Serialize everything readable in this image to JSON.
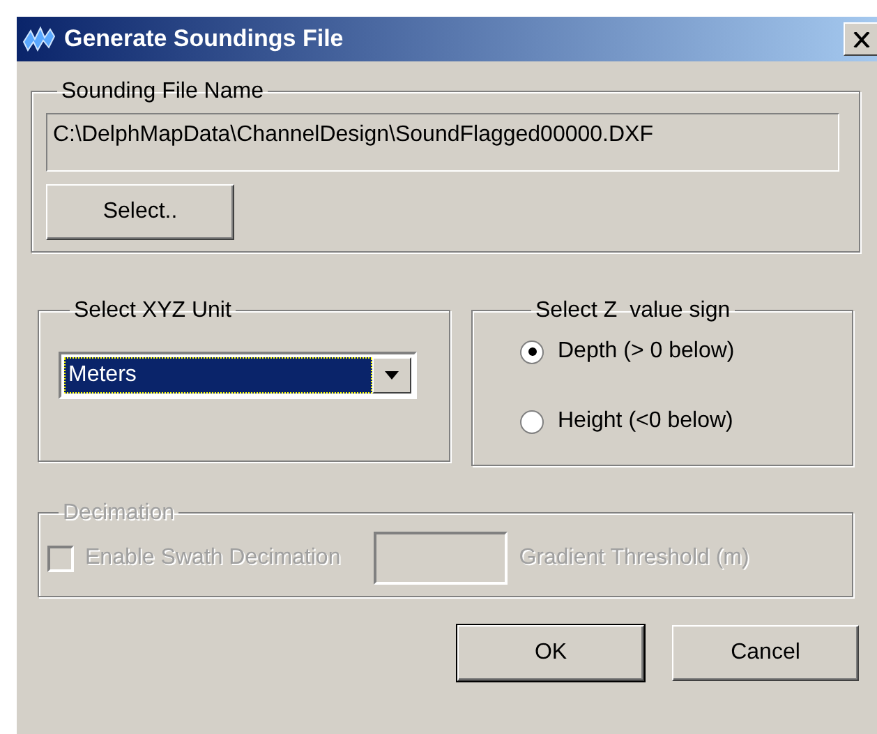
{
  "window": {
    "title": "Generate Soundings File"
  },
  "file_group": {
    "title": "Sounding File Name",
    "path": "C:\\DelphMapData\\ChannelDesign\\SoundFlagged00000.DXF",
    "button": "Select.."
  },
  "unit_group": {
    "title": "Select XYZ Unit",
    "value": "Meters"
  },
  "sign_group": {
    "title": "Select Z  value sign",
    "options": [
      {
        "label": "Depth (> 0 below)",
        "selected": true
      },
      {
        "label": "Height (<0 below)",
        "selected": false
      }
    ]
  },
  "decimation": {
    "title": "Decimation",
    "disabled": true,
    "checkbox": {
      "label": "Enable Swath Decimation",
      "checked": false
    },
    "threshold_label": "Gradient Threshold (m)"
  },
  "buttons": [
    {
      "label": "OK",
      "default": true
    },
    {
      "label": "Cancel",
      "default": false
    }
  ]
}
